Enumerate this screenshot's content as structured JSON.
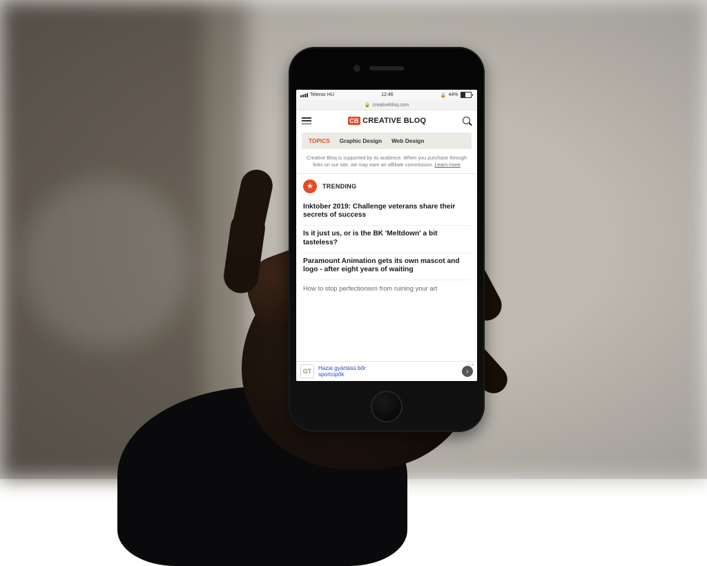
{
  "status": {
    "carrier": "Telenor HU",
    "time": "12:46",
    "battery_pct": "44%"
  },
  "urlbar": {
    "domain": "creativebloq.com"
  },
  "header": {
    "logo_badge": "CB",
    "logo_text": "CREATIVE BLOQ"
  },
  "tabs": {
    "items": [
      {
        "label": "TOPICS",
        "active": true
      },
      {
        "label": "Graphic Design",
        "active": false
      },
      {
        "label": "Web Design",
        "active": false
      }
    ]
  },
  "disclaimer": {
    "text": "Creative Bloq is supported by its audience. When you purchase through links on our site, we may earn an affiliate commission.",
    "learn_more": "Learn more"
  },
  "trending": {
    "label": "TRENDING"
  },
  "articles": [
    {
      "title": "Inktober 2019: Challenge veterans share their secrets of success"
    },
    {
      "title": "Is it just us, or is the BK 'Meltdown' a bit tasteless?"
    },
    {
      "title": "Paramount Animation gets its own mascot and logo - after eight years of waiting"
    },
    {
      "title": "How to stop perfectionism from ruining your art",
      "light": true
    }
  ],
  "ad": {
    "sponsor_badge": "GT",
    "line1": "Hazai gyártású bőr",
    "line2": "sportcipők"
  }
}
